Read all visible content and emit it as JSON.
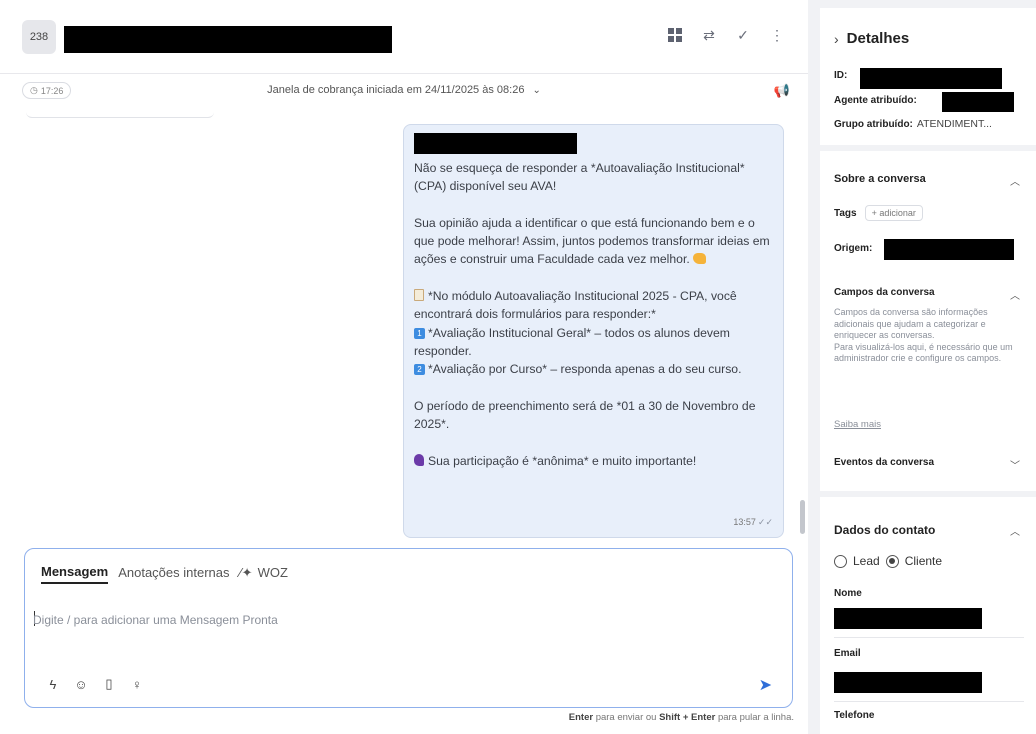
{
  "header": {
    "conversation_number": "238",
    "icons": [
      "grid-icon",
      "transfer-icon",
      "check-icon",
      "more-vert-icon"
    ]
  },
  "window_bar": {
    "timer": "17:26",
    "text": "Janela de cobrança iniciada em 24/11/2025 às 08:26"
  },
  "message": {
    "paragraphs": [
      "Não se esqueça de responder a *Autoavaliação Institucional* (CPA) disponível seu AVA!",
      "Sua opinião ajuda a identificar o que está funcionando bem e o que pode melhorar! Assim, juntos podemos transformar ideias em ações e construir uma Faculdade cada vez melhor.",
      "*No módulo Autoavaliação Institucional 2025 - CPA, você encontrará dois formulários para responder:*",
      "*Avaliação Institucional Geral* – todos os alunos devem responder.",
      "*Avaliação por Curso* – responda apenas a do seu curso.",
      "O período de preenchimento será de *01 a 30 de Novembro de 2025*.",
      "Sua participação é *anônima* e muito importante!"
    ],
    "emoji_num_1": "1",
    "emoji_num_2": "2",
    "time": "13:57",
    "ticks": "✓✓"
  },
  "composer": {
    "tab_message": "Mensagem",
    "tab_notes": "Anotações internas",
    "tab_woz": "WOZ",
    "placeholder": "Digite / para adicionar uma Mensagem Pronta",
    "hint_enter": "Enter",
    "hint_send": "para enviar ou",
    "hint_shift_enter": "Shift + Enter",
    "hint_newline": "para pular a linha."
  },
  "details": {
    "title": "Detalhes",
    "id_label": "ID:",
    "agent_label": "Agente atribuído:",
    "group_label": "Grupo atribuído:",
    "group_value": "ATENDIMENT..."
  },
  "about": {
    "title": "Sobre a conversa",
    "tags_label": "Tags",
    "tags_button": "+ adicionar",
    "origin_label": "Origem:",
    "fields_title": "Campos da conversa",
    "fields_desc_1": "Campos da conversa são informações adicionais que ajudam a categorizar e enriquecer as conversas.",
    "fields_desc_2": "Para visualizá-los aqui, é necessário que um administrador crie e configure os campos.",
    "learn_more": "Saiba mais",
    "events_title": "Eventos da conversa"
  },
  "contact": {
    "title": "Dados do contato",
    "lead_label": "Lead",
    "client_label": "Cliente",
    "selected": "Cliente",
    "name_label": "Nome",
    "email_label": "Email",
    "phone_label": "Telefone"
  },
  "colors": {
    "bubble_bg": "#e8effa",
    "send_blue": "#2f6ed8",
    "composer_border": "#8fb0ec"
  }
}
